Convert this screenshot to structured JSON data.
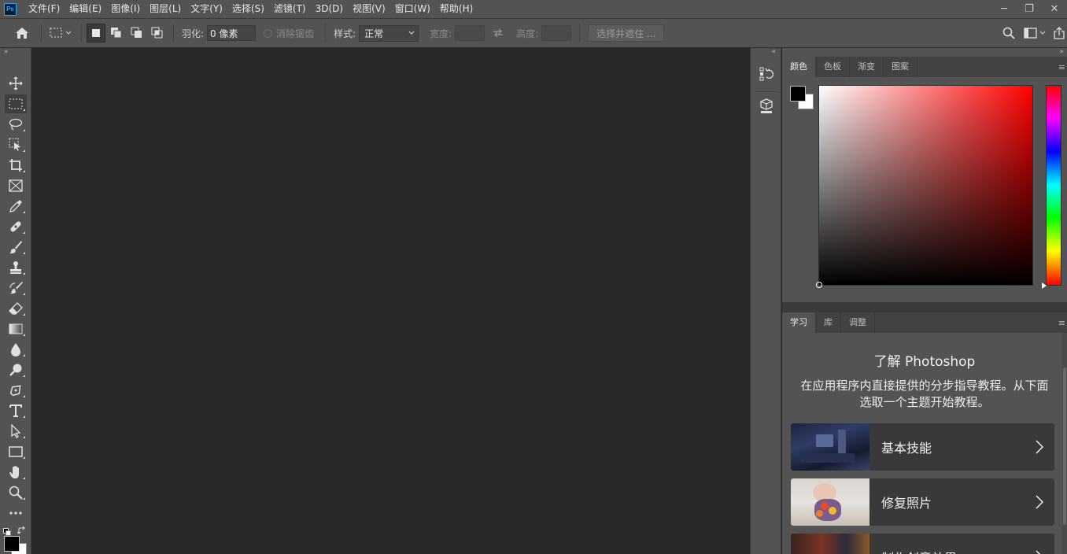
{
  "app": {
    "logo_text": "Ps"
  },
  "menubar": {
    "items": [
      "文件(F)",
      "编辑(E)",
      "图像(I)",
      "图层(L)",
      "文字(Y)",
      "选择(S)",
      "滤镜(T)",
      "3D(D)",
      "视图(V)",
      "窗口(W)",
      "帮助(H)"
    ]
  },
  "window_controls": {
    "minimize": "─",
    "restore": "❐",
    "close": "✕"
  },
  "options_bar": {
    "feather_label": "羽化:",
    "feather_value": "0 像素",
    "antialias_label": "消除锯齿",
    "style_label": "样式:",
    "style_value": "正常",
    "width_label": "宽度:",
    "height_label": "高度:",
    "select_mask_label": "选择并遮住 ..."
  },
  "tools": [
    "move-tool",
    "marquee-tool",
    "lasso-tool",
    "object-select-tool",
    "crop-tool",
    "frame-tool",
    "eyedropper-tool",
    "healing-brush-tool",
    "brush-tool",
    "clone-stamp-tool",
    "history-brush-tool",
    "eraser-tool",
    "gradient-tool",
    "blur-tool",
    "dodge-tool",
    "pen-tool",
    "type-tool",
    "path-select-tool",
    "rectangle-tool",
    "hand-tool",
    "zoom-tool",
    "more-tools"
  ],
  "color_panel": {
    "tabs": [
      "颜色",
      "色板",
      "渐变",
      "图案"
    ],
    "foreground": "#000000",
    "background": "#ffffff",
    "hue": "#ff0000"
  },
  "learn_panel": {
    "tabs": [
      "学习",
      "库",
      "调整"
    ],
    "title": "了解 Photoshop",
    "description": "在应用程序内直接提供的分步指导教程。从下面选取一个主题开始教程。",
    "cards": [
      {
        "title": "基本技能"
      },
      {
        "title": "修复照片"
      },
      {
        "title": "制作创意效果"
      }
    ]
  }
}
